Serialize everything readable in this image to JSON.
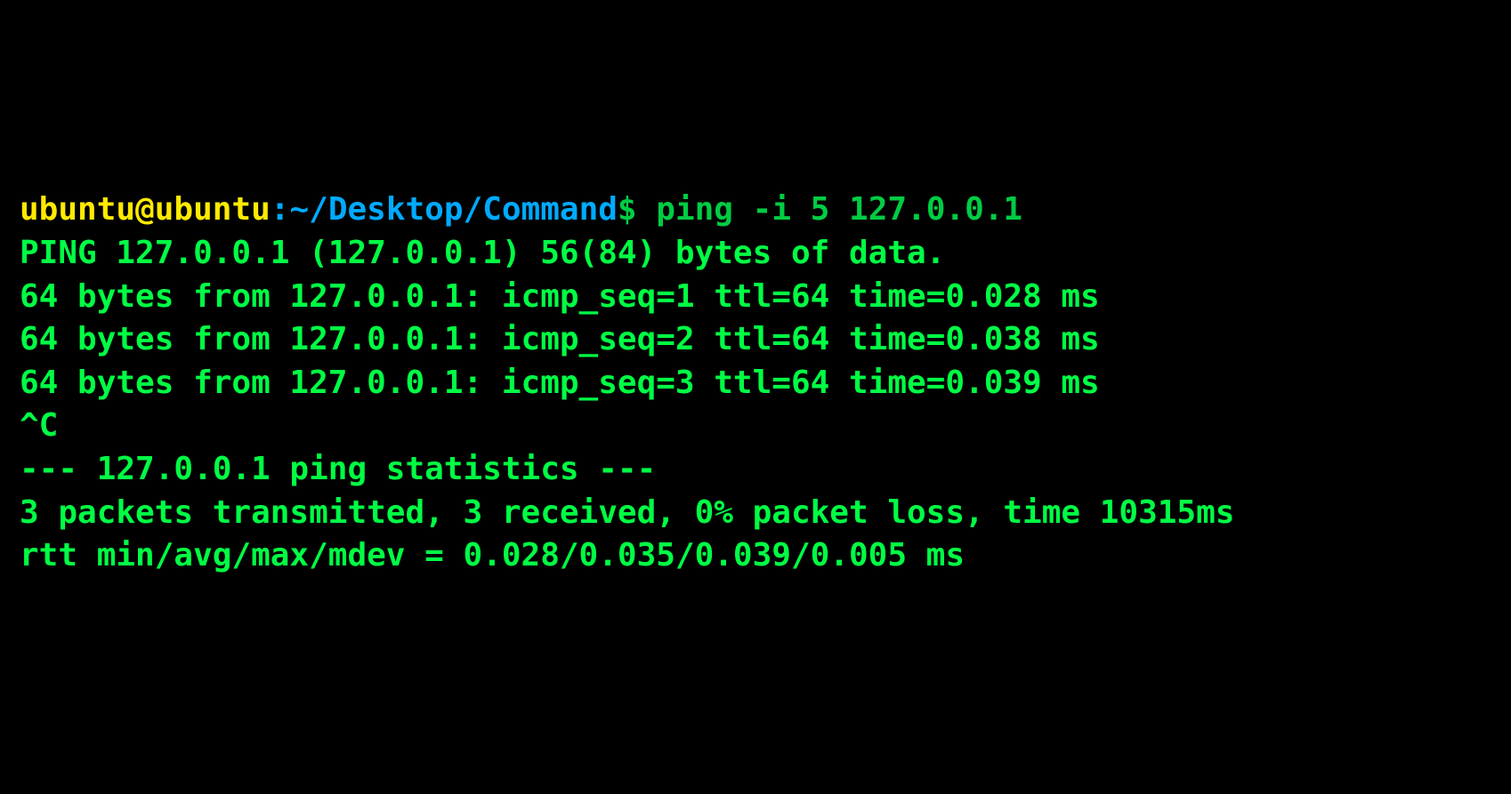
{
  "prompt": {
    "user": "ubuntu@ubuntu",
    "colon": ":",
    "tilde": "~",
    "path": "/Desktop/Command",
    "dollar": "$"
  },
  "command": " ping -i 5 127.0.0.1",
  "output_lines": [
    "PING 127.0.0.1 (127.0.0.1) 56(84) bytes of data.",
    "64 bytes from 127.0.0.1: icmp_seq=1 ttl=64 time=0.028 ms",
    "64 bytes from 127.0.0.1: icmp_seq=2 ttl=64 time=0.038 ms",
    "64 bytes from 127.0.0.1: icmp_seq=3 ttl=64 time=0.039 ms",
    "^C",
    "--- 127.0.0.1 ping statistics ---",
    "3 packets transmitted, 3 received, 0% packet loss, time 10315ms",
    "rtt min/avg/max/mdev = 0.028/0.035/0.039/0.005 ms"
  ]
}
